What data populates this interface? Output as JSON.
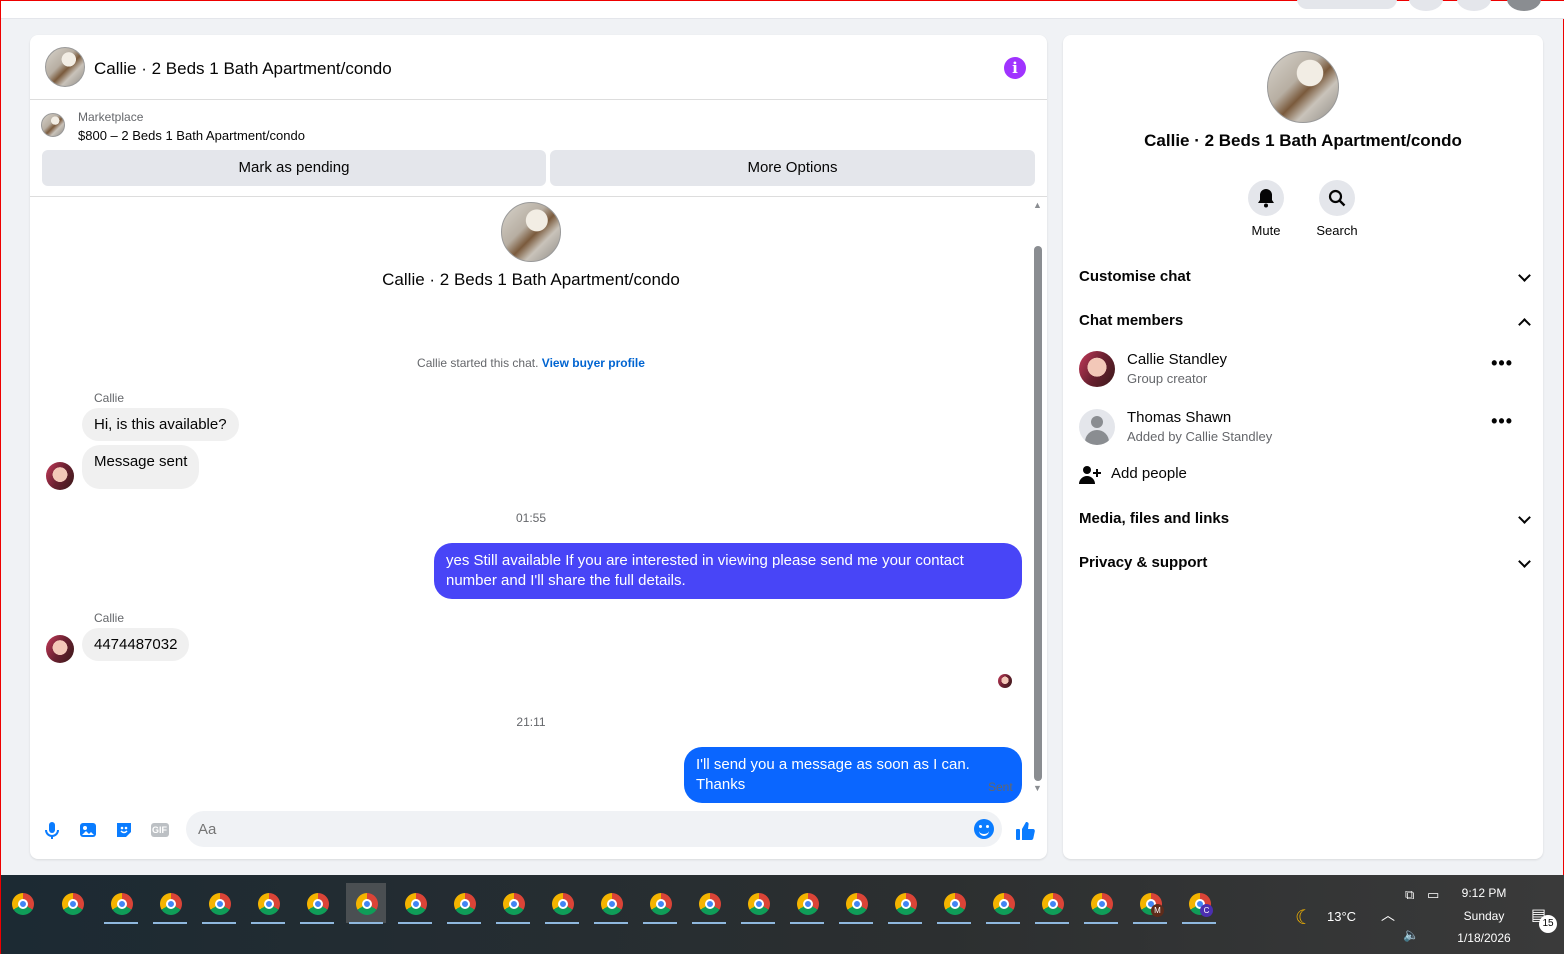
{
  "chat": {
    "header_title": "Callie · 2 Beds 1 Bath Apartment/condo",
    "info_icon": "i",
    "marketplace_label": "Marketplace",
    "listing": "$800 – 2 Beds 1 Bath Apartment/condo",
    "mark_pending": "Mark as pending",
    "more_options": "More Options",
    "thread_title": "Callie · 2 Beds 1 Bath Apartment/condo",
    "started_text": "Callie started this chat.",
    "view_buyer_profile": "View buyer profile",
    "messages": [
      {
        "sender": "Callie",
        "text": "Hi, is this available?"
      },
      {
        "text": "Message sent"
      },
      {
        "time": "01:55"
      },
      {
        "text": "yes Still available If you are interested in viewing please send me your contact number and I'll share the full details."
      },
      {
        "sender": "Callie",
        "text": "4474487032"
      },
      {
        "time": "21:11"
      },
      {
        "text": "I'll send you a message as soon as I can. Thanks"
      }
    ],
    "sent_status": "Sent",
    "input_placeholder": "Aa",
    "gif_label": "GIF"
  },
  "side": {
    "title": "Callie · 2 Beds 1 Bath Apartment/condo",
    "mute": "Mute",
    "search": "Search",
    "customise_chat": "Customise chat",
    "chat_members": "Chat members",
    "members": [
      {
        "name": "Callie Standley",
        "sub": "Group creator"
      },
      {
        "name": "Thomas Shawn",
        "sub": "Added by Callie Standley"
      }
    ],
    "more_dots": "•••",
    "add_people": "Add people",
    "media": "Media, files and links",
    "privacy": "Privacy & support"
  },
  "taskbar": {
    "temp": "13°C",
    "time": "9:12 PM",
    "day": "Sunday",
    "date": "1/18/2026",
    "notifications": "15",
    "app_badge_m": "M",
    "app_badge_c": "C"
  },
  "colors": {
    "accent": "#0a7cff",
    "bubble_out_1": "#4845f7",
    "bubble_out_2": "#0a66ff",
    "info": "#a033ff"
  }
}
